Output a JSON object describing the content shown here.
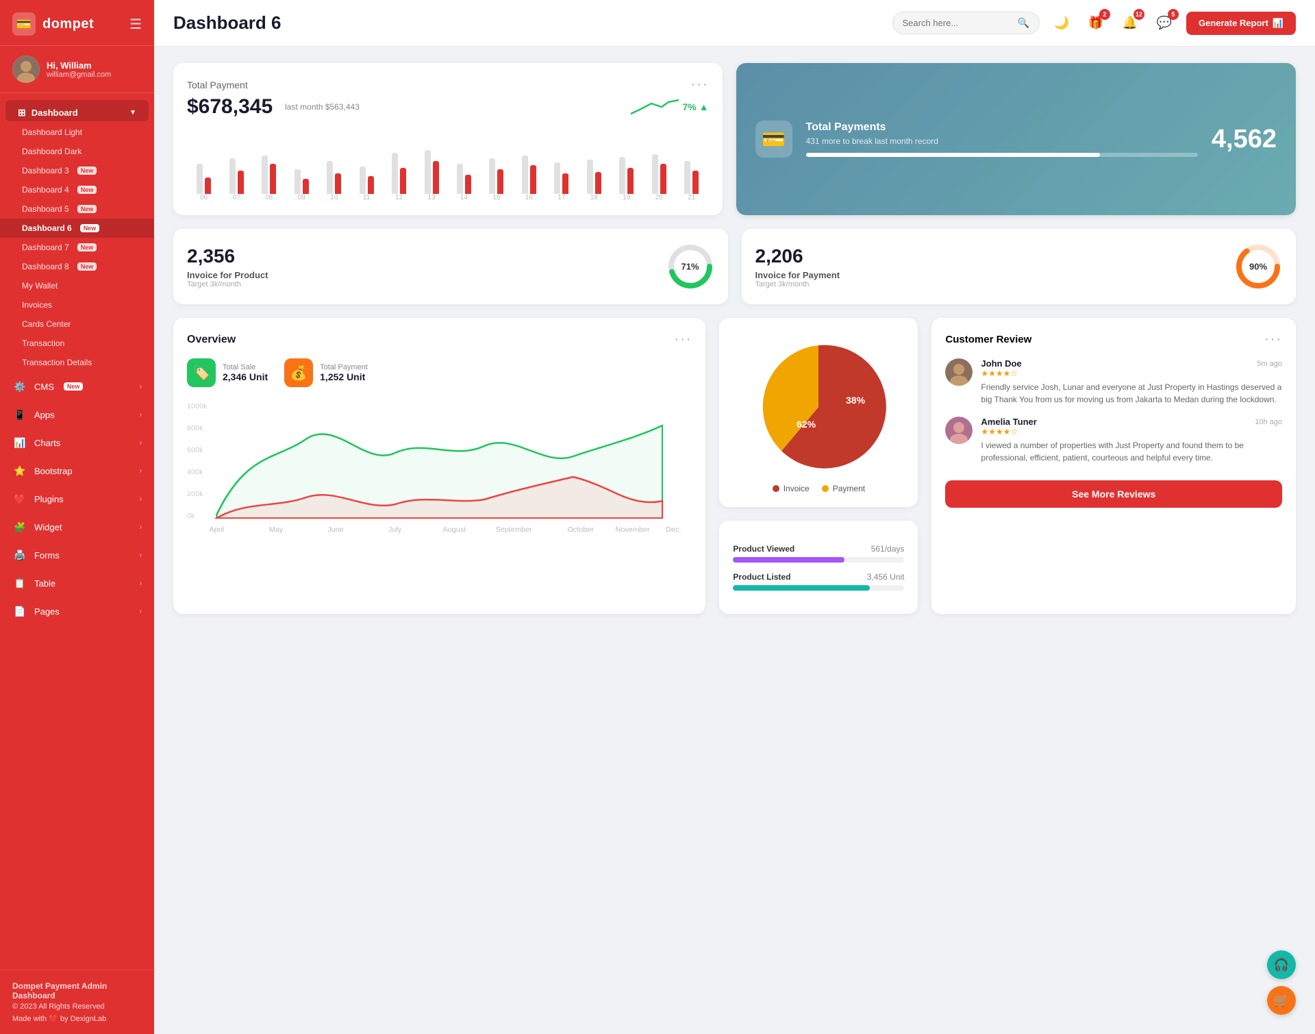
{
  "brand": {
    "name": "dompet",
    "icon": "💳"
  },
  "user": {
    "greeting": "Hi, William",
    "email": "william@gmail.com"
  },
  "sidebar": {
    "dashboard_label": "Dashboard",
    "items": [
      {
        "label": "Dashboard Light",
        "active": false,
        "badge": ""
      },
      {
        "label": "Dashboard Dark",
        "active": false,
        "badge": ""
      },
      {
        "label": "Dashboard 3",
        "active": false,
        "badge": "New"
      },
      {
        "label": "Dashboard 4",
        "active": false,
        "badge": "New"
      },
      {
        "label": "Dashboard 5",
        "active": false,
        "badge": "New"
      },
      {
        "label": "Dashboard 6",
        "active": true,
        "badge": "New"
      },
      {
        "label": "Dashboard 7",
        "active": false,
        "badge": "New"
      },
      {
        "label": "Dashboard 8",
        "active": false,
        "badge": "New"
      },
      {
        "label": "My Wallet",
        "active": false,
        "badge": ""
      },
      {
        "label": "Invoices",
        "active": false,
        "badge": ""
      },
      {
        "label": "Cards Center",
        "active": false,
        "badge": ""
      },
      {
        "label": "Transaction",
        "active": false,
        "badge": ""
      },
      {
        "label": "Transaction Details",
        "active": false,
        "badge": ""
      }
    ],
    "menu_items": [
      {
        "label": "CMS",
        "icon": "⚙️",
        "badge": "New",
        "has_arrow": true
      },
      {
        "label": "Apps",
        "icon": "📱",
        "badge": "",
        "has_arrow": true
      },
      {
        "label": "Charts",
        "icon": "📊",
        "badge": "",
        "has_arrow": true
      },
      {
        "label": "Bootstrap",
        "icon": "⭐",
        "badge": "",
        "has_arrow": true
      },
      {
        "label": "Plugins",
        "icon": "❤️",
        "badge": "",
        "has_arrow": true
      },
      {
        "label": "Widget",
        "icon": "🧩",
        "badge": "",
        "has_arrow": true
      },
      {
        "label": "Forms",
        "icon": "🖨️",
        "badge": "",
        "has_arrow": true
      },
      {
        "label": "Table",
        "icon": "📋",
        "badge": "",
        "has_arrow": true
      },
      {
        "label": "Pages",
        "icon": "📄",
        "badge": "",
        "has_arrow": true
      }
    ],
    "footer": {
      "title": "Dompet Payment Admin Dashboard",
      "copy": "© 2023 All Rights Reserved",
      "made": "Made with ❤️ by DexignLab"
    }
  },
  "header": {
    "page_title": "Dashboard 6",
    "search_placeholder": "Search here...",
    "badge_gift": "2",
    "badge_bell": "12",
    "badge_chat": "5",
    "generate_btn": "Generate Report"
  },
  "total_payment": {
    "label": "Total Payment",
    "amount": "$678,345",
    "last_month_label": "last month $563,443",
    "trend_pct": "7%",
    "bars": [
      {
        "grey": 55,
        "red": 30
      },
      {
        "grey": 65,
        "red": 42
      },
      {
        "grey": 70,
        "red": 55
      },
      {
        "grey": 45,
        "red": 28
      },
      {
        "grey": 60,
        "red": 38
      },
      {
        "grey": 50,
        "red": 32
      },
      {
        "grey": 75,
        "red": 48
      },
      {
        "grey": 80,
        "red": 60
      },
      {
        "grey": 55,
        "red": 35
      },
      {
        "grey": 65,
        "red": 45
      },
      {
        "grey": 70,
        "red": 52
      },
      {
        "grey": 58,
        "red": 38
      },
      {
        "grey": 62,
        "red": 40
      },
      {
        "grey": 68,
        "red": 48
      },
      {
        "grey": 72,
        "red": 55
      },
      {
        "grey": 60,
        "red": 42
      }
    ],
    "x_labels": [
      "06",
      "07",
      "08",
      "09",
      "10",
      "11",
      "12",
      "13",
      "14",
      "15",
      "16",
      "17",
      "18",
      "19",
      "20",
      "21"
    ]
  },
  "blue_card": {
    "title": "Total Payments",
    "sub": "431 more to break last month record",
    "number": "4,562",
    "bar_pct": 75,
    "icon": "💳"
  },
  "invoice_product": {
    "amount": "2,356",
    "label": "Invoice for Product",
    "target": "Target 3k/month",
    "pct": "71%",
    "pct_num": 71,
    "color": "#22c55e"
  },
  "invoice_payment": {
    "amount": "2,206",
    "label": "Invoice for Payment",
    "target": "Target 3k/month",
    "pct": "90%",
    "pct_num": 90,
    "color": "#f97316"
  },
  "overview": {
    "title": "Overview",
    "total_sale_label": "Total Sale",
    "total_sale_value": "2,346 Unit",
    "total_payment_label": "Total Payment",
    "total_payment_value": "1,252 Unit",
    "months": [
      "April",
      "May",
      "June",
      "July",
      "August",
      "September",
      "October",
      "November",
      "Dec."
    ],
    "y_labels": [
      "1000k",
      "800k",
      "600k",
      "400k",
      "200k",
      "0k"
    ]
  },
  "pie_chart": {
    "invoice_pct": 62,
    "payment_pct": 38,
    "invoice_label": "Invoice",
    "payment_label": "Payment",
    "invoice_color": "#c0392b",
    "payment_color": "#f0a500"
  },
  "product_stats": [
    {
      "name": "Product Viewed",
      "value": "561/days",
      "pct": 65,
      "color": "purple"
    },
    {
      "name": "Product Listed",
      "value": "3,456 Unit",
      "pct": 80,
      "color": "teal"
    }
  ],
  "customer_review": {
    "title": "Customer Review",
    "reviews": [
      {
        "name": "John Doe",
        "stars": 4,
        "time": "5m ago",
        "text": "Friendly service Josh, Lunar and everyone at Just Property in Hastings deserved a big Thank You from us for moving us from Jakarta to Medan during the lockdown."
      },
      {
        "name": "Amelia Tuner",
        "stars": 4,
        "time": "10h ago",
        "text": "I viewed a number of properties with Just Property and found them to be professional, efficient, patient, courteous and helpful every time."
      }
    ],
    "see_more_btn": "See More Reviews"
  },
  "floating": {
    "support_icon": "🎧",
    "cart_icon": "🛒"
  }
}
